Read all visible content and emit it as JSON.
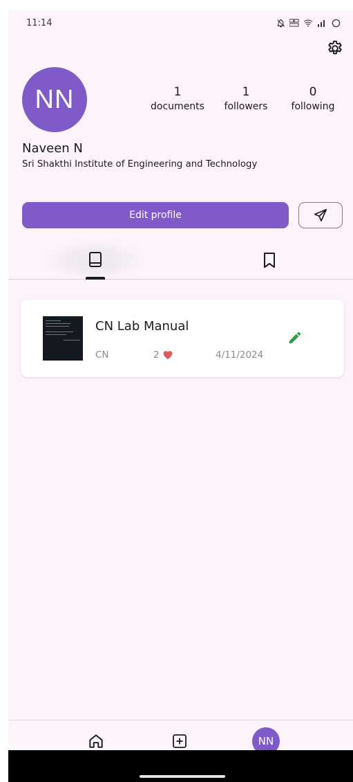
{
  "status_bar": {
    "time": "11:14",
    "icons": [
      "bell-off-icon",
      "volte-icon",
      "wifi-icon",
      "signal-icon",
      "battery-icon"
    ]
  },
  "profile": {
    "avatar_initials": "NN",
    "name": "Naveen N",
    "institute": "Sri Shakthi Institute of Engineering and Technology",
    "stats": [
      {
        "value": "1",
        "label": "documents"
      },
      {
        "value": "1",
        "label": "followers"
      },
      {
        "value": "0",
        "label": "following"
      }
    ],
    "edit_profile_label": "Edit profile",
    "accent_color": "#7f5ac8"
  },
  "tabs": [
    {
      "icon": "book-icon",
      "selected": true
    },
    {
      "icon": "bookmark-icon",
      "selected": false
    }
  ],
  "documents": [
    {
      "title": "CN Lab Manual",
      "subject": "CN",
      "likes": "2",
      "date": "4/11/2024",
      "like_color": "#e05a5a",
      "edit_color": "#2e9e45"
    }
  ],
  "bottom_nav": {
    "items": [
      "home-icon",
      "add-box-icon",
      "profile-avatar"
    ],
    "avatar_initials": "NN"
  }
}
